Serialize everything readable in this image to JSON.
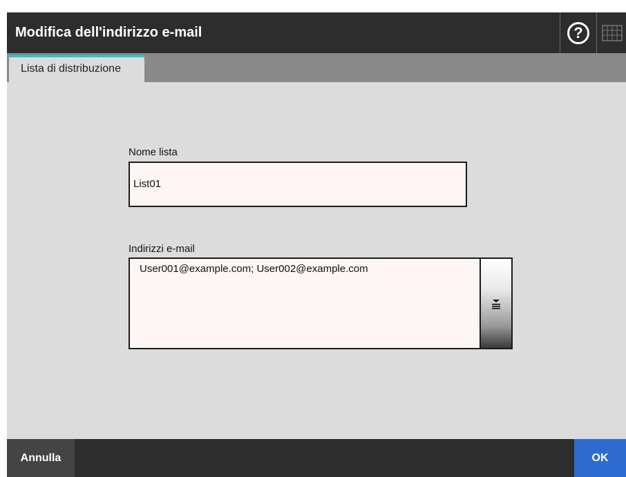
{
  "window": {
    "title": "Modifica dell'indirizzo e-mail"
  },
  "header": {
    "help_icon": "question-circle-icon",
    "help_glyph": "?",
    "keyboard_icon": "keyboard-icon"
  },
  "tabs": [
    {
      "label": "Lista di distribuzione",
      "active": true
    }
  ],
  "form": {
    "list_name_label": "Nome lista",
    "list_name_value": "List01",
    "emails_label": "Indirizzi e-mail",
    "emails_value": "User001@example.com; User002@example.com",
    "expand_icon": "expand-list-icon"
  },
  "footer": {
    "cancel_label": "Annulla",
    "ok_label": "OK"
  },
  "colors": {
    "titlebar": "#2d2d2d",
    "tab_accent": "#19c8d8",
    "ok_button": "#2e6bd1",
    "cancel_button": "#444444",
    "background": "#dcdcdc",
    "input_background": "#fdf6f5"
  }
}
